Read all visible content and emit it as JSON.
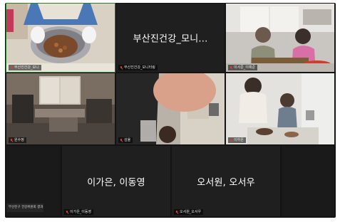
{
  "meeting": {
    "participants": [
      {
        "name_tag": "부산진건강_모니",
        "display_name": "",
        "video": true
      },
      {
        "name_tag": "부산진건강_모니터링",
        "display_name": "부산진건강_모니...",
        "video": false
      },
      {
        "name_tag": "이서준_이예준",
        "display_name": "",
        "video": true
      },
      {
        "name_tag": "원수정",
        "display_name": "",
        "video": true
      },
      {
        "name_tag": "김율",
        "display_name": "",
        "video": true
      },
      {
        "name_tag": "이하온",
        "display_name": "",
        "video": true
      },
      {
        "name_tag": "",
        "display_name": "",
        "video": false
      },
      {
        "name_tag": "이가은_이동영",
        "display_name": "이가은, 이동영",
        "video": false
      },
      {
        "name_tag": "오서원_오서우",
        "display_name": "오서원, 오서우",
        "video": false
      }
    ],
    "corner_badge": "부산진구 건강위원회 결과",
    "icons": {
      "mic": "mic-muted-icon"
    },
    "colors": {
      "background": "#141414",
      "tile": "#1f1f1f",
      "muted_mic": "#e43b3b",
      "active_speaker": "#2e7d32"
    }
  }
}
